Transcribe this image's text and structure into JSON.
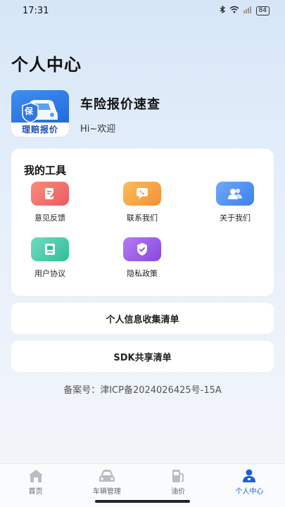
{
  "status_bar": {
    "time": "17:31",
    "battery": "84",
    "icons": [
      "bluetooth-icon",
      "wifi-icon",
      "signal-icon",
      "battery-icon"
    ]
  },
  "page": {
    "title": "个人中心"
  },
  "app": {
    "logo_text": "理赔报价",
    "logo_badge": "保",
    "name": "车险报价速查",
    "greeting": "Hi~欢迎"
  },
  "tools": {
    "title": "我的工具",
    "items": [
      {
        "label": "意见反馈",
        "icon": "feedback-icon",
        "color": "#f26a6a"
      },
      {
        "label": "联系我们",
        "icon": "phone-icon",
        "color": "#f7a341"
      },
      {
        "label": "关于我们",
        "icon": "people-icon",
        "color": "#4d8ff0"
      },
      {
        "label": "用户协议",
        "icon": "document-icon",
        "color": "#35c9a3"
      },
      {
        "label": "隐私政策",
        "icon": "shield-icon",
        "color": "#9a56e6"
      }
    ]
  },
  "links": {
    "personal_info": "个人信息收集清单",
    "sdk_share": "SDK共享清单"
  },
  "icp": "备案号：津ICP备2024026425号-15A",
  "tabbar": {
    "items": [
      {
        "label": "首页",
        "icon": "home-icon"
      },
      {
        "label": "车辆管理",
        "icon": "car-icon"
      },
      {
        "label": "油价",
        "icon": "fuel-icon"
      },
      {
        "label": "个人中心",
        "icon": "person-icon"
      }
    ],
    "active": "个人中心",
    "active_color": "#1b61d6"
  }
}
